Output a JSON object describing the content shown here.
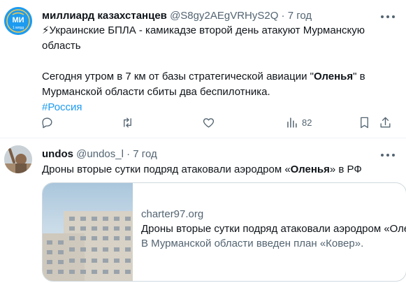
{
  "tweets": [
    {
      "author_name": "миллиард казахстанцев",
      "handle": "@S8gy2AEgVRHyS2Q",
      "separator": "·",
      "time": "7 год",
      "line1": "⚡Украинские БПЛА - камикадзе второй день атакуют Мурманскую",
      "line2": "область",
      "para2_before": "Сегодня утром в 7 км от базы стратегической авиации \"",
      "para2_bold": "Оленья",
      "para2_after": "\" в",
      "para2_line2": "Мурманской области сбиты два беспилотника.",
      "hashtag": "#Россия",
      "views": "82",
      "avatar_text": "МИ",
      "avatar_sub": "1 млрд"
    },
    {
      "author_name": "undos",
      "handle": "@undos_l",
      "separator": "·",
      "time": "7 год",
      "text_before": "Дроны вторые сутки подряд атаковали аэродром «",
      "text_bold": "Оленья",
      "text_after": "» в РФ",
      "card": {
        "domain": "charter97.org",
        "title": "Дроны вторые сутки подряд атаковали аэродром «Оленья»",
        "description": "В Мурманской области введен план «Ковер»."
      }
    }
  ],
  "icons": [
    "reply-icon",
    "retweet-icon",
    "like-icon",
    "views-icon",
    "bookmark-icon",
    "share-icon",
    "more-icon"
  ],
  "colors": {
    "accent": "#1d9bf0",
    "secondary_text": "#536471",
    "border": "#cfd9de"
  }
}
